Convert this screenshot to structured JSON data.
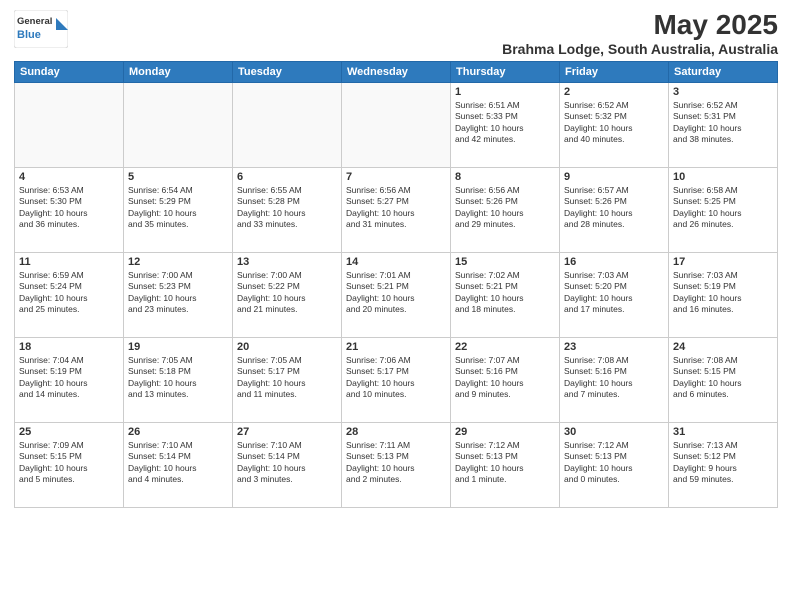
{
  "header": {
    "logo_line1": "General",
    "logo_line2": "Blue",
    "title": "May 2025",
    "subtitle": "Brahma Lodge, South Australia, Australia"
  },
  "weekdays": [
    "Sunday",
    "Monday",
    "Tuesday",
    "Wednesday",
    "Thursday",
    "Friday",
    "Saturday"
  ],
  "weeks": [
    [
      {
        "day": "",
        "info": ""
      },
      {
        "day": "",
        "info": ""
      },
      {
        "day": "",
        "info": ""
      },
      {
        "day": "",
        "info": ""
      },
      {
        "day": "1",
        "info": "Sunrise: 6:51 AM\nSunset: 5:33 PM\nDaylight: 10 hours\nand 42 minutes."
      },
      {
        "day": "2",
        "info": "Sunrise: 6:52 AM\nSunset: 5:32 PM\nDaylight: 10 hours\nand 40 minutes."
      },
      {
        "day": "3",
        "info": "Sunrise: 6:52 AM\nSunset: 5:31 PM\nDaylight: 10 hours\nand 38 minutes."
      }
    ],
    [
      {
        "day": "4",
        "info": "Sunrise: 6:53 AM\nSunset: 5:30 PM\nDaylight: 10 hours\nand 36 minutes."
      },
      {
        "day": "5",
        "info": "Sunrise: 6:54 AM\nSunset: 5:29 PM\nDaylight: 10 hours\nand 35 minutes."
      },
      {
        "day": "6",
        "info": "Sunrise: 6:55 AM\nSunset: 5:28 PM\nDaylight: 10 hours\nand 33 minutes."
      },
      {
        "day": "7",
        "info": "Sunrise: 6:56 AM\nSunset: 5:27 PM\nDaylight: 10 hours\nand 31 minutes."
      },
      {
        "day": "8",
        "info": "Sunrise: 6:56 AM\nSunset: 5:26 PM\nDaylight: 10 hours\nand 29 minutes."
      },
      {
        "day": "9",
        "info": "Sunrise: 6:57 AM\nSunset: 5:26 PM\nDaylight: 10 hours\nand 28 minutes."
      },
      {
        "day": "10",
        "info": "Sunrise: 6:58 AM\nSunset: 5:25 PM\nDaylight: 10 hours\nand 26 minutes."
      }
    ],
    [
      {
        "day": "11",
        "info": "Sunrise: 6:59 AM\nSunset: 5:24 PM\nDaylight: 10 hours\nand 25 minutes."
      },
      {
        "day": "12",
        "info": "Sunrise: 7:00 AM\nSunset: 5:23 PM\nDaylight: 10 hours\nand 23 minutes."
      },
      {
        "day": "13",
        "info": "Sunrise: 7:00 AM\nSunset: 5:22 PM\nDaylight: 10 hours\nand 21 minutes."
      },
      {
        "day": "14",
        "info": "Sunrise: 7:01 AM\nSunset: 5:21 PM\nDaylight: 10 hours\nand 20 minutes."
      },
      {
        "day": "15",
        "info": "Sunrise: 7:02 AM\nSunset: 5:21 PM\nDaylight: 10 hours\nand 18 minutes."
      },
      {
        "day": "16",
        "info": "Sunrise: 7:03 AM\nSunset: 5:20 PM\nDaylight: 10 hours\nand 17 minutes."
      },
      {
        "day": "17",
        "info": "Sunrise: 7:03 AM\nSunset: 5:19 PM\nDaylight: 10 hours\nand 16 minutes."
      }
    ],
    [
      {
        "day": "18",
        "info": "Sunrise: 7:04 AM\nSunset: 5:19 PM\nDaylight: 10 hours\nand 14 minutes."
      },
      {
        "day": "19",
        "info": "Sunrise: 7:05 AM\nSunset: 5:18 PM\nDaylight: 10 hours\nand 13 minutes."
      },
      {
        "day": "20",
        "info": "Sunrise: 7:05 AM\nSunset: 5:17 PM\nDaylight: 10 hours\nand 11 minutes."
      },
      {
        "day": "21",
        "info": "Sunrise: 7:06 AM\nSunset: 5:17 PM\nDaylight: 10 hours\nand 10 minutes."
      },
      {
        "day": "22",
        "info": "Sunrise: 7:07 AM\nSunset: 5:16 PM\nDaylight: 10 hours\nand 9 minutes."
      },
      {
        "day": "23",
        "info": "Sunrise: 7:08 AM\nSunset: 5:16 PM\nDaylight: 10 hours\nand 7 minutes."
      },
      {
        "day": "24",
        "info": "Sunrise: 7:08 AM\nSunset: 5:15 PM\nDaylight: 10 hours\nand 6 minutes."
      }
    ],
    [
      {
        "day": "25",
        "info": "Sunrise: 7:09 AM\nSunset: 5:15 PM\nDaylight: 10 hours\nand 5 minutes."
      },
      {
        "day": "26",
        "info": "Sunrise: 7:10 AM\nSunset: 5:14 PM\nDaylight: 10 hours\nand 4 minutes."
      },
      {
        "day": "27",
        "info": "Sunrise: 7:10 AM\nSunset: 5:14 PM\nDaylight: 10 hours\nand 3 minutes."
      },
      {
        "day": "28",
        "info": "Sunrise: 7:11 AM\nSunset: 5:13 PM\nDaylight: 10 hours\nand 2 minutes."
      },
      {
        "day": "29",
        "info": "Sunrise: 7:12 AM\nSunset: 5:13 PM\nDaylight: 10 hours\nand 1 minute."
      },
      {
        "day": "30",
        "info": "Sunrise: 7:12 AM\nSunset: 5:13 PM\nDaylight: 10 hours\nand 0 minutes."
      },
      {
        "day": "31",
        "info": "Sunrise: 7:13 AM\nSunset: 5:12 PM\nDaylight: 9 hours\nand 59 minutes."
      }
    ]
  ]
}
